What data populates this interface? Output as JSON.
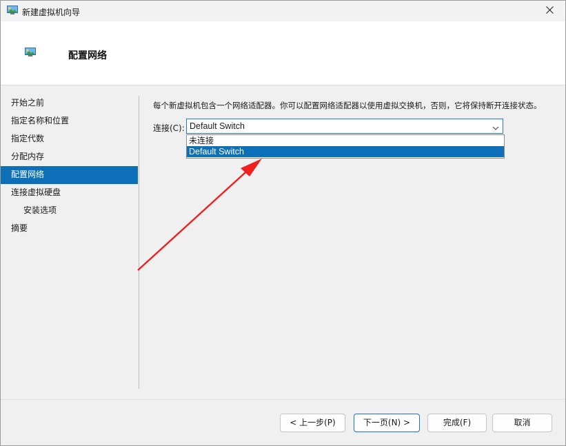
{
  "window": {
    "title": "新建虚拟机向导"
  },
  "header": {
    "title": "配置网络"
  },
  "sidebar": {
    "items": [
      {
        "label": "开始之前"
      },
      {
        "label": "指定名称和位置"
      },
      {
        "label": "指定代数"
      },
      {
        "label": "分配内存"
      },
      {
        "label": "配置网络"
      },
      {
        "label": "连接虚拟硬盘"
      },
      {
        "label": "安装选项"
      },
      {
        "label": "摘要"
      }
    ],
    "active_index": 4
  },
  "main": {
    "description": "每个新虚拟机包含一个网络适配器。你可以配置网络适配器以使用虚拟交换机，否则，它将保持断开连接状态。",
    "connection_label": "连接(C):",
    "connection_value": "Default Switch",
    "options": [
      "未连接",
      "Default Switch"
    ],
    "selected_option": 1
  },
  "buttons": {
    "prev": "< 上一步(P)",
    "next": "下一页(N) >",
    "finish": "完成(F)",
    "cancel": "取消"
  },
  "colors": {
    "accent": "#0d6fb8",
    "annotation_arrow": "#f0201e"
  },
  "icons": {
    "title": "virtual-machine-icon",
    "header": "virtual-machine-icon",
    "close": "close-icon",
    "dropdown": "chevron-down-icon"
  }
}
